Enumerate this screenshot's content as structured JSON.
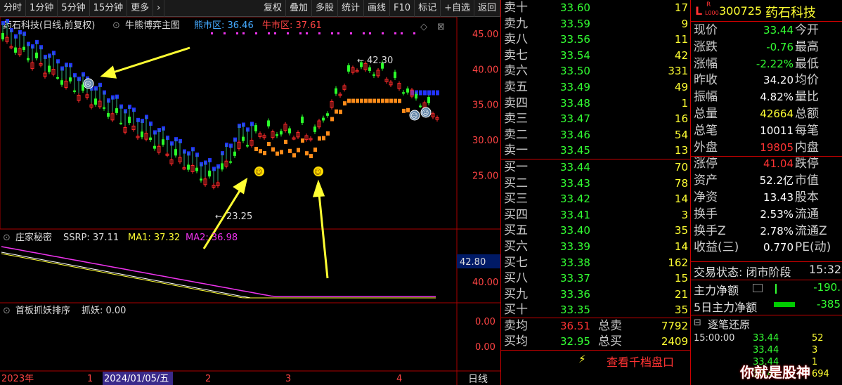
{
  "toolbar": {
    "left": [
      "分时",
      "1分钟",
      "5分钟",
      "15分钟",
      "更多"
    ],
    "more_arrow": "›",
    "right": [
      "复权",
      "叠加",
      "多股",
      "统计",
      "画线",
      "F10",
      "标记",
      "+自选",
      "返回"
    ]
  },
  "main_chart": {
    "title": "药石科技(日线,前复权)",
    "indicator": "牛熊博弈主图",
    "bear_label": "熊市区: 36.46",
    "bull_label": "牛市区: 37.61",
    "high_label": "42.30",
    "low_label": "23.25",
    "y_ticks": [
      "45.00",
      "40.00",
      "35.00",
      "30.00",
      "25.00"
    ],
    "colors": {
      "up": "#ff2a2a",
      "down": "#2aff2a",
      "bear": "#2233ff",
      "bull": "#ff8c1a",
      "accent": "#ffff33"
    }
  },
  "sub1": {
    "title": "庄家秘密",
    "ssrp": "SSRP: 37.11",
    "ma1": "MA1: 37.32",
    "ma2": "MA2: 36.98",
    "cursor_value": "42.80",
    "y_tick": "40.00"
  },
  "sub2": {
    "title": "首板抓妖排序",
    "value": "抓妖: 0.00",
    "y_ticks": [
      "0.00",
      "0.00"
    ]
  },
  "time_axis": {
    "labels": [
      "2023年",
      "1",
      "2024/01/05/五",
      "2",
      "3",
      "4"
    ],
    "period": "日线"
  },
  "order_book": {
    "sells": [
      {
        "label": "卖十",
        "price": "33.60",
        "vol": "17"
      },
      {
        "label": "卖九",
        "price": "33.59",
        "vol": "9"
      },
      {
        "label": "卖八",
        "price": "33.56",
        "vol": "11"
      },
      {
        "label": "卖七",
        "price": "33.54",
        "vol": "42"
      },
      {
        "label": "卖六",
        "price": "33.50",
        "vol": "331"
      },
      {
        "label": "卖五",
        "price": "33.49",
        "vol": "49"
      },
      {
        "label": "卖四",
        "price": "33.48",
        "vol": "1"
      },
      {
        "label": "卖三",
        "price": "33.47",
        "vol": "16"
      },
      {
        "label": "卖二",
        "price": "33.46",
        "vol": "54"
      },
      {
        "label": "卖一",
        "price": "33.45",
        "vol": "13"
      }
    ],
    "buys": [
      {
        "label": "买一",
        "price": "33.44",
        "vol": "70"
      },
      {
        "label": "买二",
        "price": "33.43",
        "vol": "78"
      },
      {
        "label": "买三",
        "price": "33.42",
        "vol": "14"
      },
      {
        "label": "买四",
        "price": "33.41",
        "vol": "3"
      },
      {
        "label": "买五",
        "price": "33.40",
        "vol": "35"
      },
      {
        "label": "买六",
        "price": "33.39",
        "vol": "14"
      },
      {
        "label": "买七",
        "price": "33.38",
        "vol": "162"
      },
      {
        "label": "买八",
        "price": "33.37",
        "vol": "15"
      },
      {
        "label": "买九",
        "price": "33.36",
        "vol": "21"
      },
      {
        "label": "买十",
        "price": "33.35",
        "vol": "35"
      }
    ],
    "avg_sell_label": "卖均",
    "avg_sell": "36.51",
    "total_sell_label": "总卖",
    "total_sell": "7792",
    "avg_buy_label": "买均",
    "avg_buy": "32.95",
    "total_buy_label": "总买",
    "total_buy": "2409",
    "view_more": "查看千档盘口"
  },
  "quote": {
    "badge_l": "L",
    "badge_r": "R",
    "badge_sub": "L000",
    "code": "300725",
    "name": "药石科技",
    "rows": [
      {
        "l": "现价",
        "v": "33.44",
        "c": "green",
        "r": "今开"
      },
      {
        "l": "涨跌",
        "v": "-0.76",
        "c": "green",
        "r": "最高"
      },
      {
        "l": "涨幅",
        "v": "-2.22%",
        "c": "green",
        "r": "最低"
      },
      {
        "l": "昨收",
        "v": "34.20",
        "c": "white",
        "r": "均价"
      },
      {
        "l": "振幅",
        "v": "4.82%",
        "c": "white",
        "r": "量比"
      },
      {
        "l": "总量",
        "v": "42664",
        "c": "yel",
        "r": "总额"
      },
      {
        "l": "总笔",
        "v": "10011",
        "c": "white",
        "r": "每笔"
      },
      {
        "l": "外盘",
        "v": "19805",
        "c": "red",
        "r": "内盘"
      },
      {
        "l": "涨停",
        "v": "41.04",
        "c": "red",
        "r": "跌停"
      },
      {
        "l": "资产",
        "v": "52.2亿",
        "c": "white",
        "r": "市值"
      },
      {
        "l": "净资",
        "v": "13.43",
        "c": "white",
        "r": "股本"
      },
      {
        "l": "换手",
        "v": "2.53%",
        "c": "white",
        "r": "流通"
      },
      {
        "l": "换手Z",
        "v": "2.78%",
        "c": "white",
        "r": "流通Z"
      },
      {
        "l": "收益(三)",
        "v": "0.770",
        "c": "white",
        "r": "PE(动)"
      }
    ],
    "trade_status": "交易状态: 闭市阶段",
    "trade_time": "15:32",
    "main_net_label": "主力净额",
    "main_net": "-190.",
    "main_net5_label": "5日主力净额",
    "main_net5": "-385",
    "ticks_title": "逐笔还原",
    "ticks": [
      {
        "t": "15:00:00",
        "p": "33.44",
        "v": "52"
      },
      {
        "t": "",
        "p": "33.44",
        "v": "3"
      },
      {
        "t": "",
        "p": "33.44",
        "v": "1"
      },
      {
        "t": "",
        "p": "33.44",
        "v": "694"
      }
    ],
    "watermark": "你就是股神"
  }
}
